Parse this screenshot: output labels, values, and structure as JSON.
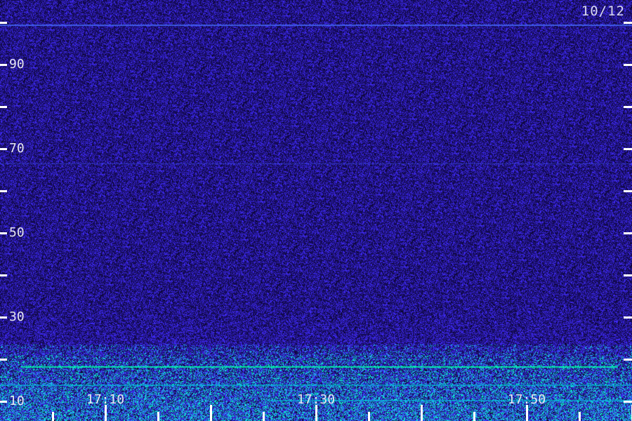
{
  "date_label": "10/12",
  "chart_data": {
    "type": "heatmap",
    "title": "",
    "xlabel": "",
    "ylabel": "",
    "x_ticks": [
      "17:10",
      "17:30",
      "17:50"
    ],
    "x_minor_ticks_count": 12,
    "y_ticks": [
      10,
      30,
      50,
      70,
      90
    ],
    "y_minor_ticks": [
      20,
      40,
      60,
      80,
      100
    ],
    "ylim": [
      7,
      105
    ],
    "colors": {
      "background": "#150c5c",
      "noise": "#4a2cff",
      "strong": "#00ffc0"
    }
  }
}
